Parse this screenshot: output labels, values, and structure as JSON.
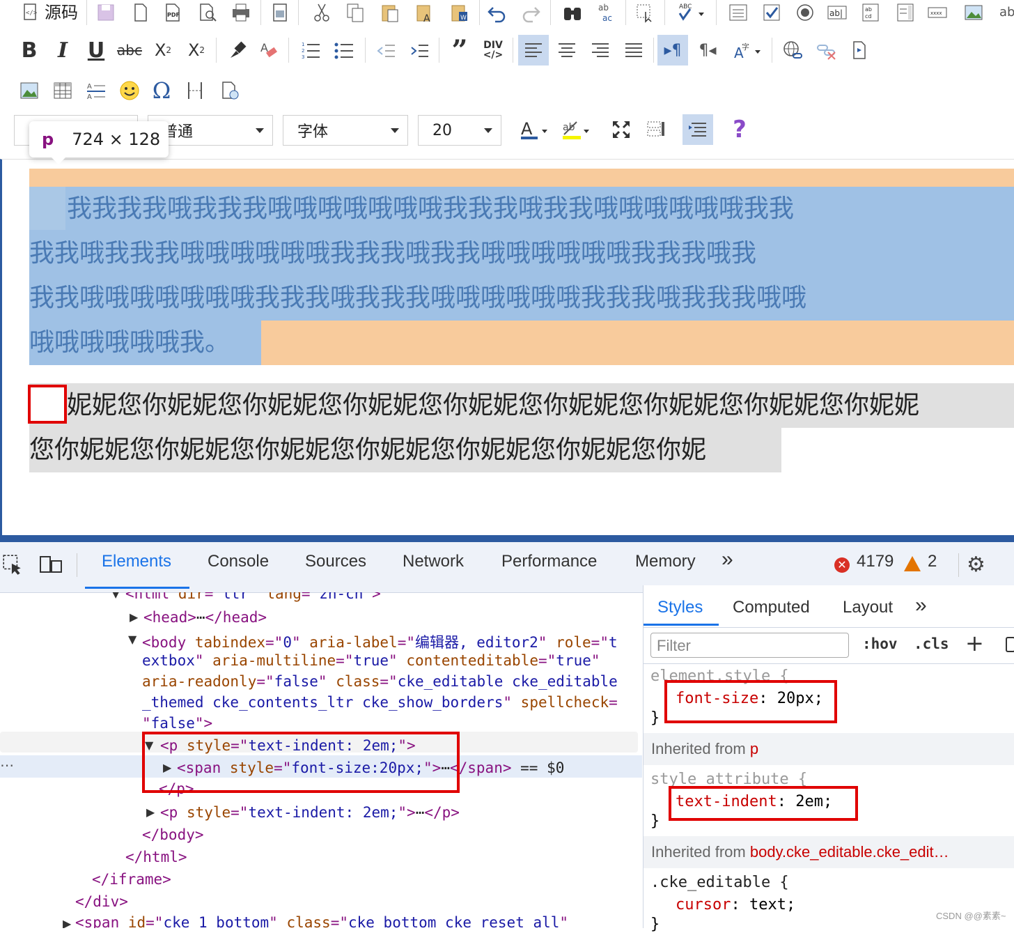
{
  "toolbar": {
    "source_label": "源码",
    "div_label": "DIV",
    "abc_label": "ABC",
    "ab_label": "ab",
    "ac_label": "ac"
  },
  "combos": {
    "format": "普通",
    "font": "字体",
    "size": "20"
  },
  "tooltip": {
    "tag": "p",
    "dims": "724 × 128"
  },
  "content": {
    "para1_lines": [
      "我我我我哦我我我哦哦哦哦哦哦哦我我我哦我我哦哦哦哦哦哦我我",
      "我我哦我我我哦哦哦哦哦哦我我我哦我我哦哦哦哦哦哦我我我哦我",
      "我我哦哦哦哦哦哦哦我我我哦我我我哦哦哦哦哦哦我我我哦我我我哦哦",
      "哦哦哦哦哦哦我。"
    ],
    "para2_lines": [
      "妮妮您你妮妮您你妮妮您你妮妮您你妮妮您你妮妮您你妮妮您你妮妮您你妮妮",
      "您你妮妮您你妮妮您你妮妮您你妮妮您你妮妮您你妮妮您你妮"
    ]
  },
  "devtools": {
    "tabs": [
      "Elements",
      "Console",
      "Sources",
      "Network",
      "Performance",
      "Memory"
    ],
    "more": "»",
    "error_count": "4179",
    "warning_count": "2",
    "dom_lines": [
      {
        "parts": [
          {
            "c": "tagc",
            "t": "<html "
          },
          {
            "c": "attr",
            "t": "dir"
          },
          {
            "c": "tagc",
            "t": "=\""
          },
          {
            "c": "val",
            "t": "ltr"
          },
          {
            "c": "tagc",
            "t": "\" "
          },
          {
            "c": "attr",
            "t": "lang"
          },
          {
            "c": "tagc",
            "t": "=\""
          },
          {
            "c": "val",
            "t": "zh-cn"
          },
          {
            "c": "tagc",
            "t": "\">"
          }
        ]
      },
      {
        "parts": [
          {
            "c": "tagc",
            "t": "<head>"
          },
          {
            "c": "txt",
            "t": "⋯"
          },
          {
            "c": "tagc",
            "t": "</head>"
          }
        ]
      },
      {
        "parts": [
          {
            "c": "tagc",
            "t": "<body "
          },
          {
            "c": "attr",
            "t": "tabindex"
          },
          {
            "c": "tagc",
            "t": "=\""
          },
          {
            "c": "val",
            "t": "0"
          },
          {
            "c": "tagc",
            "t": "\" "
          },
          {
            "c": "attr",
            "t": "aria-label"
          },
          {
            "c": "tagc",
            "t": "=\""
          },
          {
            "c": "val",
            "t": "编辑器, editor2"
          },
          {
            "c": "tagc",
            "t": "\" "
          },
          {
            "c": "attr",
            "t": "role"
          },
          {
            "c": "tagc",
            "t": "=\""
          },
          {
            "c": "val",
            "t": "t"
          }
        ]
      },
      {
        "parts": [
          {
            "c": "val",
            "t": "extbox"
          },
          {
            "c": "tagc",
            "t": "\" "
          },
          {
            "c": "attr",
            "t": "aria-multiline"
          },
          {
            "c": "tagc",
            "t": "=\""
          },
          {
            "c": "val",
            "t": "true"
          },
          {
            "c": "tagc",
            "t": "\" "
          },
          {
            "c": "attr",
            "t": "contenteditable"
          },
          {
            "c": "tagc",
            "t": "=\""
          },
          {
            "c": "val",
            "t": "true"
          },
          {
            "c": "tagc",
            "t": "\""
          }
        ]
      },
      {
        "parts": [
          {
            "c": "attr",
            "t": "aria-readonly"
          },
          {
            "c": "tagc",
            "t": "=\""
          },
          {
            "c": "val",
            "t": "false"
          },
          {
            "c": "tagc",
            "t": "\" "
          },
          {
            "c": "attr",
            "t": "class"
          },
          {
            "c": "tagc",
            "t": "=\""
          },
          {
            "c": "val",
            "t": "cke_editable cke_editable"
          }
        ]
      },
      {
        "parts": [
          {
            "c": "val",
            "t": "_themed cke_contents_ltr cke_show_borders"
          },
          {
            "c": "tagc",
            "t": "\" "
          },
          {
            "c": "attr",
            "t": "spellcheck"
          },
          {
            "c": "tagc",
            "t": "="
          }
        ]
      },
      {
        "parts": [
          {
            "c": "tagc",
            "t": "\""
          },
          {
            "c": "val",
            "t": "false"
          },
          {
            "c": "tagc",
            "t": "\">"
          }
        ]
      },
      {
        "parts": [
          {
            "c": "tagc",
            "t": "<p "
          },
          {
            "c": "attr",
            "t": "style"
          },
          {
            "c": "tagc",
            "t": "=\""
          },
          {
            "c": "val",
            "t": "text-indent: 2em;"
          },
          {
            "c": "tagc",
            "t": "\">"
          }
        ]
      },
      {
        "parts": [
          {
            "c": "tagc",
            "t": "<span "
          },
          {
            "c": "attr",
            "t": "style"
          },
          {
            "c": "tagc",
            "t": "=\""
          },
          {
            "c": "val",
            "t": "font-size:20px;"
          },
          {
            "c": "tagc",
            "t": "\">"
          },
          {
            "c": "txt",
            "t": "⋯"
          },
          {
            "c": "tagc",
            "t": "</span>"
          },
          {
            "c": "txt",
            "t": " == $0"
          }
        ]
      },
      {
        "parts": [
          {
            "c": "tagc",
            "t": "</p>"
          }
        ]
      },
      {
        "parts": [
          {
            "c": "tagc",
            "t": "<p "
          },
          {
            "c": "attr",
            "t": "style"
          },
          {
            "c": "tagc",
            "t": "=\""
          },
          {
            "c": "val",
            "t": "text-indent: 2em;"
          },
          {
            "c": "tagc",
            "t": "\">"
          },
          {
            "c": "txt",
            "t": "⋯"
          },
          {
            "c": "tagc",
            "t": "</p>"
          }
        ]
      },
      {
        "parts": [
          {
            "c": "tagc",
            "t": "</body>"
          }
        ]
      },
      {
        "parts": [
          {
            "c": "tagc",
            "t": "</html>"
          }
        ]
      },
      {
        "parts": [
          {
            "c": "tagc",
            "t": "</iframe>"
          }
        ]
      },
      {
        "parts": [
          {
            "c": "tagc",
            "t": "</div>"
          }
        ]
      },
      {
        "parts": [
          {
            "c": "tagc",
            "t": "<span "
          },
          {
            "c": "attr",
            "t": "id"
          },
          {
            "c": "tagc",
            "t": "=\""
          },
          {
            "c": "val",
            "t": "cke_1_bottom"
          },
          {
            "c": "tagc",
            "t": "\" "
          },
          {
            "c": "attr",
            "t": "class"
          },
          {
            "c": "tagc",
            "t": "=\""
          },
          {
            "c": "val",
            "t": "cke_bottom cke_reset_all"
          },
          {
            "c": "tagc",
            "t": "\""
          }
        ]
      }
    ],
    "styles_tabs": [
      "Styles",
      "Computed",
      "Layout"
    ],
    "filter_placeholder": "Filter",
    "hov": ":hov",
    "cls": ".cls",
    "element_style_selector": "element.style {",
    "rule1_prop": "font-size",
    "rule1_val": "20px;",
    "inherited_p_label": "Inherited from",
    "inherited_p_tag": "p",
    "style_attr_selector": "style attribute {",
    "rule2_prop": "text-indent",
    "rule2_val": "2em;",
    "inherited_body_label": "Inherited from",
    "inherited_body_tag": "body.cke_editable.cke_edit…",
    "cke_selector": ".cke_editable {",
    "rule3_prop": "cursor",
    "rule3_val": "text;",
    "close_brace": "}",
    "watermark": "CSDN @@素素~"
  }
}
